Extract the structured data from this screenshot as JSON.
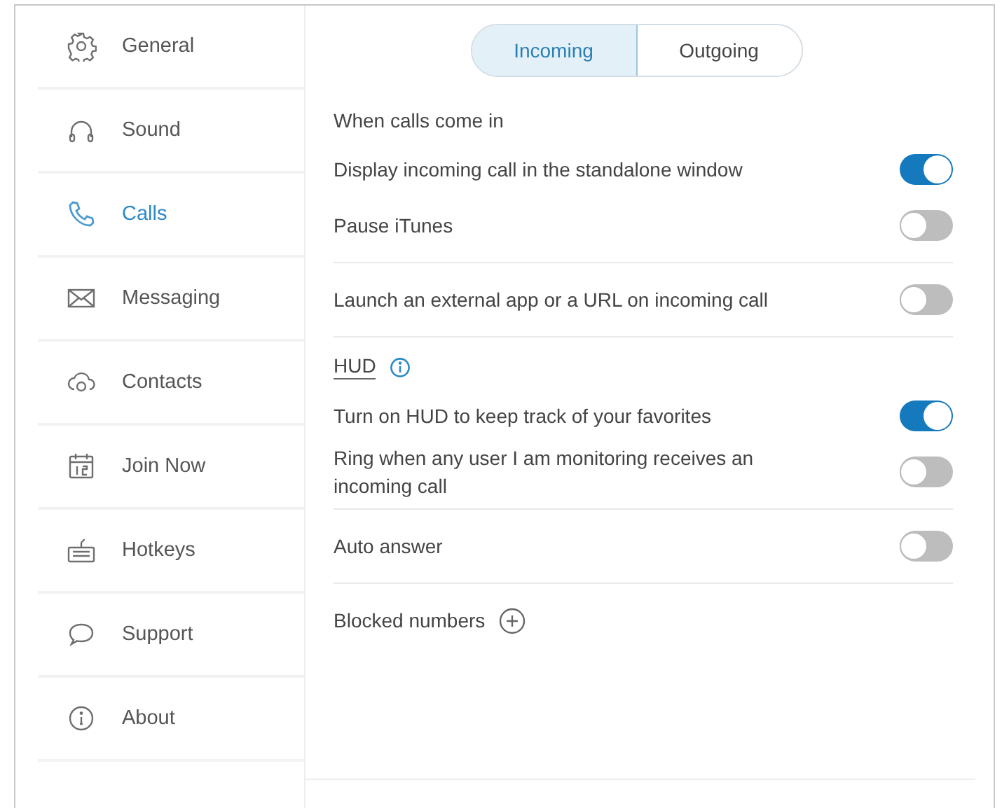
{
  "sidebar": {
    "items": [
      {
        "kind": "gear",
        "label": "General",
        "selected": false
      },
      {
        "kind": "headphones",
        "label": "Sound",
        "selected": false
      },
      {
        "kind": "phone",
        "label": "Calls",
        "selected": true
      },
      {
        "kind": "envelope",
        "label": "Messaging",
        "selected": false
      },
      {
        "kind": "cloud",
        "label": "Contacts",
        "selected": false
      },
      {
        "kind": "calendar",
        "label": "Join Now",
        "selected": false
      },
      {
        "kind": "keyboard",
        "label": "Hotkeys",
        "selected": false
      },
      {
        "kind": "bubble",
        "label": "Support",
        "selected": false
      },
      {
        "kind": "info",
        "label": "About",
        "selected": false
      }
    ]
  },
  "tabs": [
    {
      "label": "Incoming",
      "selected": true
    },
    {
      "label": "Outgoing",
      "selected": false
    }
  ],
  "groups": [
    {
      "heading": {
        "kind": "plain",
        "label": "When calls come in"
      },
      "rows": [
        {
          "kind": "toggle",
          "label": "Display incoming call in the standalone window",
          "on": true
        },
        {
          "kind": "toggle",
          "label": "Pause iTunes",
          "on": false
        }
      ]
    },
    {
      "rows": [
        {
          "kind": "toggle",
          "label": "Launch an external app or a URL on incoming call",
          "on": false
        }
      ]
    },
    {
      "heading": {
        "kind": "link",
        "label": "HUD"
      },
      "rows": [
        {
          "kind": "toggle",
          "label": "Turn on HUD to keep track of your favorites",
          "on": true
        },
        {
          "kind": "toggle",
          "label": "Ring when any user I am monitoring receives an incoming call",
          "on": false
        }
      ]
    },
    {
      "rows": [
        {
          "kind": "toggle",
          "label": "Auto answer",
          "on": false
        }
      ]
    },
    {
      "rows": [
        {
          "kind": "add",
          "label": "Blocked numbers"
        }
      ]
    }
  ]
}
